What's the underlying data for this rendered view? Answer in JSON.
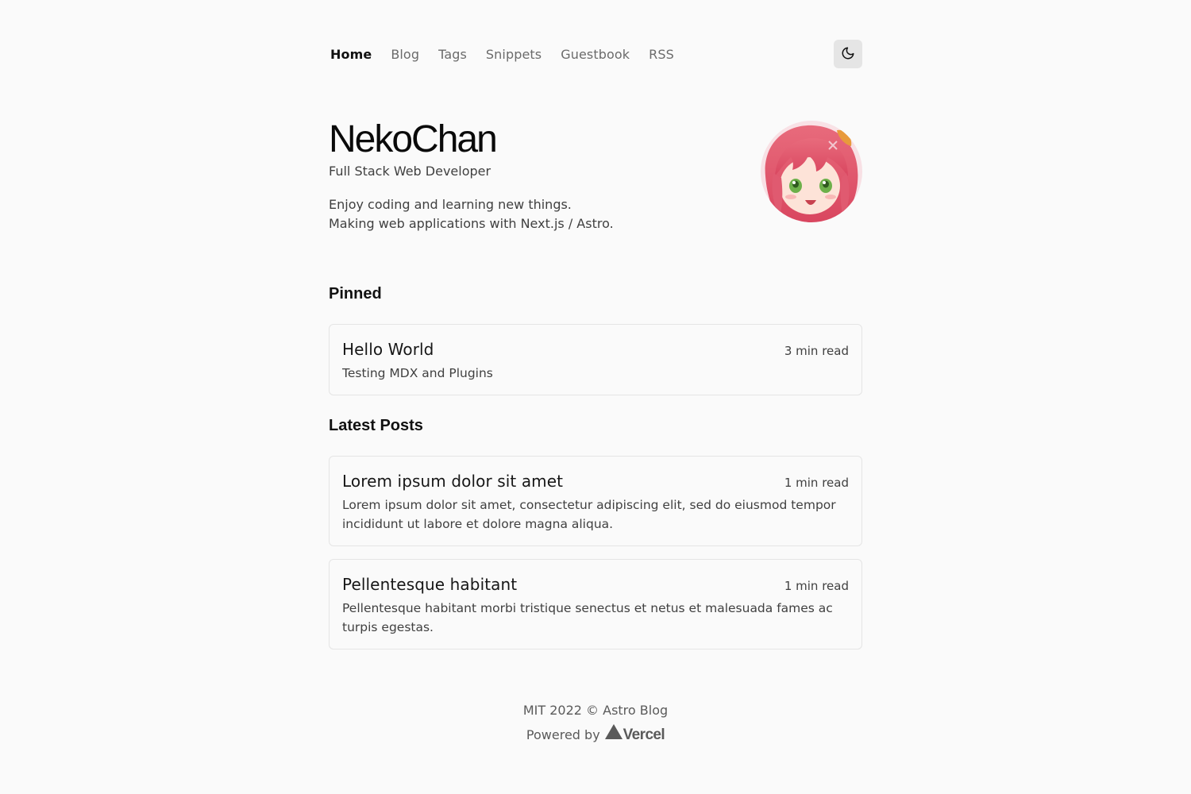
{
  "nav": {
    "items": [
      {
        "label": "Home",
        "active": true
      },
      {
        "label": "Blog",
        "active": false
      },
      {
        "label": "Tags",
        "active": false
      },
      {
        "label": "Snippets",
        "active": false
      },
      {
        "label": "Guestbook",
        "active": false
      },
      {
        "label": "RSS",
        "active": false
      }
    ],
    "theme_toggle_icon": "moon-icon"
  },
  "hero": {
    "name": "NekoChan",
    "role": "Full Stack Web Developer",
    "bio_line1": "Enjoy coding and learning new things.",
    "bio_line2": "Making web applications with Next.js / Astro."
  },
  "pinned": {
    "title": "Pinned",
    "posts": [
      {
        "title": "Hello World",
        "read_time": "3 min read",
        "description": "Testing MDX and Plugins"
      }
    ]
  },
  "latest": {
    "title": "Latest Posts",
    "posts": [
      {
        "title": "Lorem ipsum dolor sit amet",
        "read_time": "1 min read",
        "description": "Lorem ipsum dolor sit amet, consectetur adipiscing elit, sed do eiusmod tempor incididunt ut labore et dolore magna aliqua."
      },
      {
        "title": "Pellentesque habitant",
        "read_time": "1 min read",
        "description": "Pellentesque habitant morbi tristique senectus et netus et malesuada fames ac turpis egestas."
      }
    ]
  },
  "footer": {
    "copyright": "MIT 2022 © Astro Blog",
    "powered_by": "Powered by",
    "vercel_label": "Vercel"
  },
  "colors": {
    "background": "#fafafa",
    "card_border": "#e5e5e5",
    "text_primary": "#171717",
    "text_muted": "#404040",
    "theme_button_bg": "#e5e5e5"
  }
}
